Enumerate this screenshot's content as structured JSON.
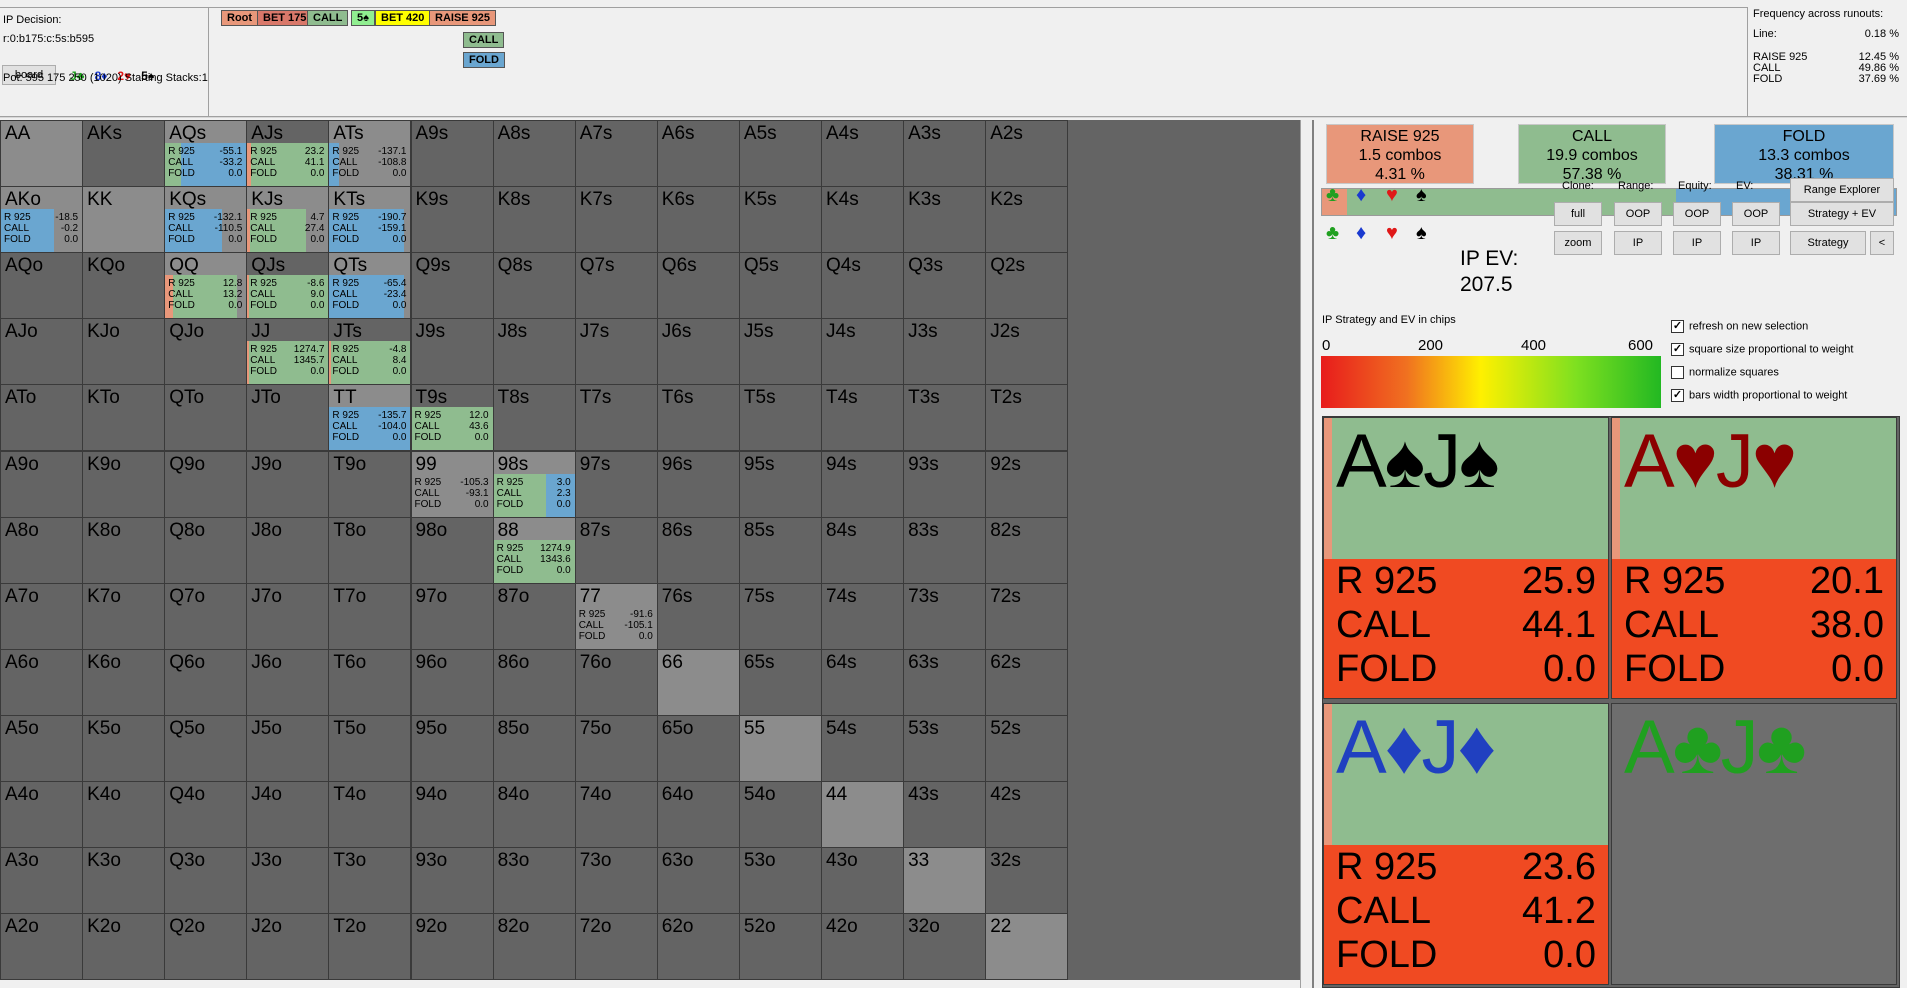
{
  "info": {
    "decision": "IP Decision:",
    "line": "r:0:b175:c:5s:b595",
    "board_button": "board",
    "board_cards": [
      {
        "text": "J♣",
        "color": "#20a020"
      },
      {
        "text": "8♦",
        "color": "#1a3ad0"
      },
      {
        "text": "2♥",
        "color": "#e01818"
      },
      {
        "text": "5♠",
        "color": "#000000"
      }
    ],
    "pot": "Pot: 595 175 250 (1020) Starting Stacks:1"
  },
  "tree": {
    "row1": [
      {
        "label": "Root",
        "color": "#e8977a"
      },
      {
        "label": "BET 175",
        "color": "#d9786a"
      },
      {
        "label": "CALL",
        "color": "#8fbc8f"
      },
      {
        "label": "5♠",
        "color": "#90ee90"
      },
      {
        "label": "BET 420",
        "color": "#ffff00"
      },
      {
        "label": "RAISE 925",
        "color": "#e8977a"
      }
    ],
    "children": [
      {
        "label": "CALL",
        "color": "#8fbc8f"
      },
      {
        "label": "FOLD",
        "color": "#6aa6d0"
      }
    ]
  },
  "frequency": {
    "title": "Frequency across runouts:",
    "line_label": "Line:",
    "line_value": "0.18 %",
    "rows": [
      {
        "name": "RAISE 925",
        "value": "12.45 %"
      },
      {
        "name": "CALL",
        "value": "49.86 %"
      },
      {
        "name": "FOLD",
        "value": "37.69 %"
      }
    ]
  },
  "colors": {
    "raise": "#e8977a",
    "call": "#8fbc8f",
    "fold": "#6aa6d0",
    "empty": "#646464",
    "diag": "#8c8c8c",
    "ev_red": "#f04a22"
  },
  "matrix": {
    "ranks": [
      "A",
      "K",
      "Q",
      "J",
      "T",
      "9",
      "8",
      "7",
      "6",
      "5",
      "4",
      "3",
      "2"
    ],
    "cells": {
      "AA": {
        "weight": 1.0,
        "mix": [
          0,
          0,
          0
        ],
        "gray": true
      },
      "AQs": {
        "weight": 1.0,
        "mix": [
          0,
          0.2,
          0.8
        ],
        "ev": [
          "-55.1",
          "-33.2",
          "0.0"
        ],
        "gray": true
      },
      "AJs": {
        "weight": 1.0,
        "mix": [
          0.04,
          0.96,
          0
        ],
        "ev": [
          "23.2",
          "41.1",
          "0.0"
        ]
      },
      "ATs": {
        "weight": 1.0,
        "mix": [
          0,
          0,
          0.12
        ],
        "ev": [
          "-137.1",
          "-108.8",
          "0.0"
        ],
        "gray": true
      },
      "AKo": {
        "weight": 1.0,
        "mix": [
          0,
          0,
          0.65
        ],
        "ev": [
          "-18.5",
          "-0.2",
          "0.0"
        ],
        "gray": true
      },
      "KK": {
        "weight": 1.0,
        "mix": [
          0,
          0,
          0
        ],
        "gray": true
      },
      "KQs": {
        "weight": 1.0,
        "mix": [
          0,
          0,
          0.7
        ],
        "ev": [
          "-132.1",
          "-110.5",
          "0.0"
        ],
        "gray": true
      },
      "KJs": {
        "weight": 1.0,
        "mix": [
          0.03,
          0.7,
          0
        ],
        "ev": [
          "4.7",
          "27.4",
          "0.0"
        ],
        "gray": true
      },
      "KTs": {
        "weight": 1.0,
        "mix": [
          0,
          0,
          0.92
        ],
        "ev": [
          "-190.7",
          "-159.1",
          "0.0"
        ],
        "gray": true
      },
      "QQ": {
        "weight": 1.0,
        "mix": [
          0.1,
          0.78,
          0
        ],
        "ev": [
          "12.8",
          "13.2",
          "0.0"
        ],
        "gray": true
      },
      "QJs": {
        "weight": 1.0,
        "mix": [
          0.02,
          0.98,
          0
        ],
        "ev": [
          "-8.6",
          "9.0",
          "0.0"
        ]
      },
      "QTs": {
        "weight": 1.0,
        "mix": [
          0,
          0,
          0.92
        ],
        "ev": [
          "-65.4",
          "-23.4",
          "0.0"
        ],
        "gray": true
      },
      "JJ": {
        "weight": 1.0,
        "mix": [
          0.02,
          0.98,
          0
        ],
        "ev": [
          "1274.7",
          "1345.7",
          "0.0"
        ]
      },
      "JTs": {
        "weight": 1.0,
        "mix": [
          0.02,
          0.98,
          0
        ],
        "ev": [
          "-4.8",
          "8.4",
          "0.0"
        ]
      },
      "TT": {
        "weight": 1.0,
        "mix": [
          0,
          0,
          1.0
        ],
        "ev": [
          "-135.7",
          "-104.0",
          "0.0"
        ],
        "gray": true
      },
      "T9s": {
        "weight": 1.0,
        "mix": [
          0,
          1.0,
          0
        ],
        "ev": [
          "12.0",
          "43.6",
          "0.0"
        ]
      },
      "99": {
        "weight": 1.0,
        "mix": [
          0,
          0,
          0
        ],
        "ev": [
          "-105.3",
          "-93.1",
          "0.0"
        ],
        "gray": true
      },
      "98s": {
        "weight": 1.0,
        "mix": [
          0,
          0.65,
          0.35
        ],
        "ev": [
          "3.0",
          "2.3",
          "0.0"
        ],
        "gray": true
      },
      "88": {
        "weight": 1.0,
        "mix": [
          0,
          1.0,
          0
        ],
        "ev": [
          "1274.9",
          "1343.6",
          "0.0"
        ],
        "gray": true
      },
      "77": {
        "weight": 1.0,
        "mix": [
          0,
          0,
          0
        ],
        "ev": [
          "-91.6",
          "-105.1",
          "0.0"
        ],
        "gray": true
      },
      "66": {
        "weight": 1.0,
        "mix": [
          0,
          0,
          0
        ],
        "gray": true
      },
      "55": {
        "weight": 1.0,
        "mix": [
          0,
          0,
          0
        ],
        "gray": true
      },
      "44": {
        "weight": 1.0,
        "mix": [
          0,
          0,
          0
        ],
        "gray": true
      },
      "33": {
        "weight": 1.0,
        "mix": [
          0,
          0,
          0
        ],
        "gray": true
      },
      "22": {
        "weight": 1.0,
        "mix": [
          0,
          0,
          0
        ],
        "gray": true
      }
    },
    "ev_names": [
      "R 925",
      "CALL",
      "FOLD"
    ]
  },
  "strategy": {
    "boxes": [
      {
        "name": "RAISE 925",
        "combos": "1.5 combos",
        "pct": "4.31 %",
        "color": "#e8977a"
      },
      {
        "name": "CALL",
        "combos": "19.9 combos",
        "pct": "57.38 %",
        "color": "#8fbc8f"
      },
      {
        "name": "FOLD",
        "combos": "13.3 combos",
        "pct": "38.31 %",
        "color": "#6aa6d0"
      }
    ],
    "ratio": [
      0.0431,
      0.5738,
      0.3831
    ]
  },
  "controls": {
    "suits_row1": [
      {
        "glyph": "♣",
        "color": "#20a020"
      },
      {
        "glyph": "♦",
        "color": "#1a3ad0"
      },
      {
        "glyph": "♥",
        "color": "#e01818"
      },
      {
        "glyph": "♠",
        "color": "#000000"
      }
    ],
    "suits_row2": [
      {
        "glyph": "♣",
        "color": "#20a020"
      },
      {
        "glyph": "♦",
        "color": "#1a3ad0"
      },
      {
        "glyph": "♥",
        "color": "#e01818"
      },
      {
        "glyph": "♠",
        "color": "#000000"
      }
    ],
    "ev_label": "IP EV:",
    "ev_value": "207.5",
    "labels": {
      "clone": "Clone:",
      "range": "Range:",
      "equity": "Equity:",
      "ev": "EV:"
    },
    "buttons": {
      "full": "full",
      "zoom": "zoom",
      "range_oop": "OOP",
      "range_ip": "IP",
      "equity_oop": "OOP",
      "equity_ip": "IP",
      "ev_oop": "OOP",
      "ev_ip": "IP",
      "range_explorer": "Range Explorer",
      "strategy_ev": "Strategy + EV",
      "strategy": "Strategy",
      "collapse": "<"
    }
  },
  "gradient": {
    "title": "IP Strategy and EV in chips",
    "ticks": [
      "0",
      "200",
      "400",
      "600"
    ]
  },
  "checkboxes": [
    {
      "label": "refresh on new selection",
      "checked": true
    },
    {
      "label": "square size proportional to weight",
      "checked": true
    },
    {
      "label": "normalize squares",
      "checked": false
    },
    {
      "label": "bars width proportional to weight",
      "checked": true
    }
  ],
  "combos": [
    {
      "rank1": "A",
      "rank2": "J",
      "suit": "♠",
      "color": "#000000",
      "ev": [
        {
          "name": "R 925",
          "value": "25.9"
        },
        {
          "name": "CALL",
          "value": "44.1"
        },
        {
          "name": "FOLD",
          "value": "0.0"
        }
      ]
    },
    {
      "rank1": "A",
      "rank2": "J",
      "suit": "♥",
      "color": "#8b0000",
      "ev": [
        {
          "name": "R 925",
          "value": "20.1"
        },
        {
          "name": "CALL",
          "value": "38.0"
        },
        {
          "name": "FOLD",
          "value": "0.0"
        }
      ]
    },
    {
      "rank1": "A",
      "rank2": "J",
      "suit": "♦",
      "color": "#2040c0",
      "ev": [
        {
          "name": "R 925",
          "value": "23.6"
        },
        {
          "name": "CALL",
          "value": "41.2"
        },
        {
          "name": "FOLD",
          "value": "0.0"
        }
      ]
    },
    {
      "rank1": "A",
      "rank2": "J",
      "suit": "♣",
      "color": "#20a020",
      "ev": []
    }
  ]
}
